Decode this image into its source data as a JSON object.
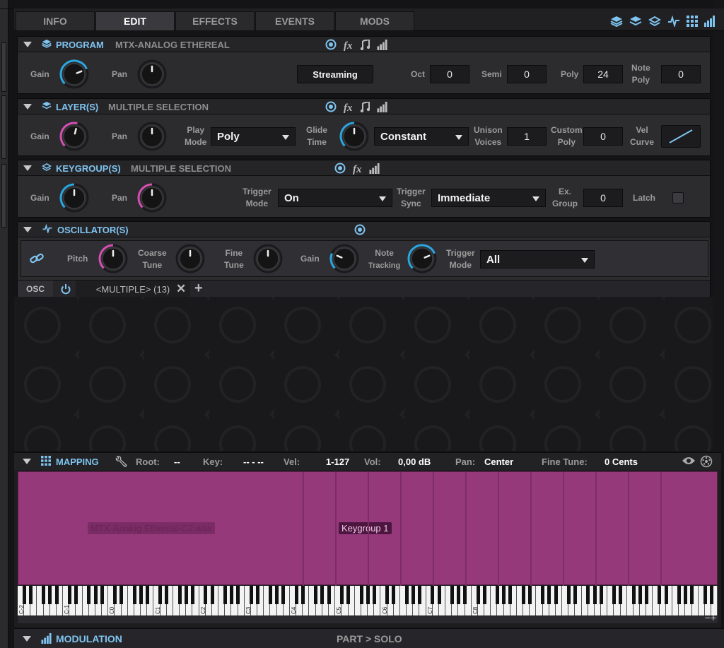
{
  "tabs": [
    {
      "label": "INFO"
    },
    {
      "label": "EDIT"
    },
    {
      "label": "EFFECTS"
    },
    {
      "label": "EVENTS"
    },
    {
      "label": "MODS"
    }
  ],
  "program": {
    "title": "PROGRAM",
    "name": "MTX-ANALOG ETHEREAL",
    "gain_label": "Gain",
    "pan_label": "Pan",
    "streaming_label": "Streaming",
    "oct_label": "Oct",
    "oct_value": "0",
    "semi_label": "Semi",
    "semi_value": "0",
    "poly_label": "Poly",
    "poly_value": "24",
    "note_poly_label1": "Note",
    "note_poly_label2": "Poly",
    "note_poly_value": "0"
  },
  "layers": {
    "title": "LAYER(S)",
    "name": "MULTIPLE SELECTION",
    "gain_label": "Gain",
    "pan_label": "Pan",
    "play_mode_label1": "Play",
    "play_mode_label2": "Mode",
    "play_mode_value": "Poly",
    "glide_label1": "Glide",
    "glide_label2": "Time",
    "glide_mode_value": "Constant",
    "unison_label1": "Unison",
    "unison_label2": "Voices",
    "unison_value": "1",
    "custom_poly_label1": "Custom",
    "custom_poly_label2": "Poly",
    "custom_poly_value": "0",
    "vel_curve_label1": "Vel",
    "vel_curve_label2": "Curve"
  },
  "keygroups": {
    "title": "KEYGROUP(S)",
    "name": "MULTIPLE SELECTION",
    "gain_label": "Gain",
    "pan_label": "Pan",
    "trigger_mode_label1": "Trigger",
    "trigger_mode_label2": "Mode",
    "trigger_mode_value": "On",
    "trigger_sync_label1": "Trigger",
    "trigger_sync_label2": "Sync",
    "trigger_sync_value": "Immediate",
    "ex_group_label1": "Ex.",
    "ex_group_label2": "Group",
    "ex_group_value": "0",
    "latch_label": "Latch"
  },
  "oscillators": {
    "title": "OSCILLATOR(S)",
    "pitch_label": "Pitch",
    "coarse_label1": "Coarse",
    "coarse_label2": "Tune",
    "fine_label1": "Fine",
    "fine_label2": "Tune",
    "gain_label": "Gain",
    "note_tracking_label1": "Note",
    "note_tracking_label2": "Tracking",
    "trigger_mode_label1": "Trigger",
    "trigger_mode_label2": "Mode",
    "trigger_mode_value": "All",
    "osc_tab_label": "OSC",
    "osc_selection": "<MULTIPLE> (13)"
  },
  "mapping": {
    "title": "MAPPING",
    "root_label": "Root:",
    "root_value": "--",
    "key_label": "Key:",
    "key_value": "-- - --",
    "vel_label": "Vel:",
    "vel_value": "1-127",
    "vol_label": "Vol:",
    "vol_value": "0,00 dB",
    "pan_label": "Pan:",
    "pan_value": "Center",
    "fine_tune_label": "Fine Tune:",
    "fine_tune_value": "0 Cents",
    "sample_label": "MTX-Analog Ethereal-C2.wav",
    "keygroup_label": "Keygroup 1",
    "octaves": [
      "C-2",
      "C-1",
      "C0",
      "C1",
      "C2",
      "C3",
      "C4",
      "C5",
      "C6",
      "C7",
      "C8"
    ]
  },
  "modulation": {
    "title": "MODULATION",
    "part_solo": "PART > SOLO"
  },
  "colors": {
    "accent": "#7fc4f0",
    "zone": "#95397b",
    "knob_ring_blue": "#2aa6e0",
    "knob_ring_pink": "#d64fb2"
  }
}
